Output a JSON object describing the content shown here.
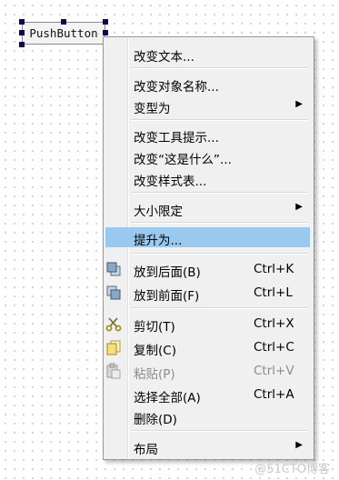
{
  "widget": {
    "text": "PushButton"
  },
  "menu": {
    "change_text": "改变文本...",
    "change_object_name": "改变对象名称...",
    "morph_into": "变型为",
    "change_tooltip": "改变工具提示...",
    "change_whats_this": "改变“这是什么”...",
    "change_stylesheet": "改变样式表...",
    "size_constraints": "大小限定",
    "promote_to": "提升为...",
    "send_to_back": "放到后面(B)",
    "send_to_back_shortcut": "Ctrl+K",
    "bring_to_front": "放到前面(F)",
    "bring_to_front_shortcut": "Ctrl+L",
    "cut": "剪切(T)",
    "cut_shortcut": "Ctrl+X",
    "copy": "复制(C)",
    "copy_shortcut": "Ctrl+C",
    "paste": "粘贴(P)",
    "paste_shortcut": "Ctrl+V",
    "select_all": "选择全部(A)",
    "select_all_shortcut": "Ctrl+A",
    "delete": "删除(D)",
    "layout": "布局",
    "submenu_arrow": "▶"
  },
  "watermark": "@51CTO博客",
  "colors": {
    "highlight": "#99c9ef",
    "menu_bg": "#f0f0f0",
    "handle": "#0a0a52"
  },
  "icons": [
    "send-to-back-icon",
    "bring-to-front-icon",
    "scissors-icon",
    "copy-icon",
    "paste-icon"
  ]
}
